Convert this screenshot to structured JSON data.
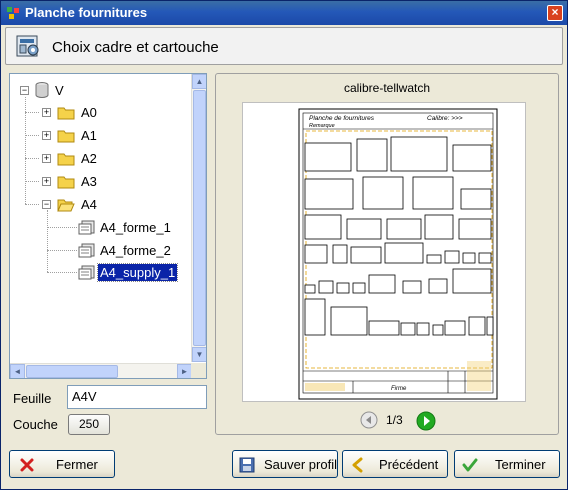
{
  "window": {
    "title": "Planche fournitures",
    "close": "×"
  },
  "header": {
    "title": "Choix cadre et cartouche"
  },
  "tree": {
    "root": "V",
    "folders": [
      "A0",
      "A1",
      "A2",
      "A3",
      "A4"
    ],
    "items": [
      "A4_forme_1",
      "A4_forme_2",
      "A4_supply_1"
    ],
    "selected": "A4_supply_1",
    "scroll_up": "▲",
    "scroll_down": "▼",
    "scroll_left": "◄",
    "scroll_right": "►"
  },
  "form": {
    "feuille_label": "Feuille",
    "feuille_value": "A4V",
    "couche_label": "Couche",
    "couche_value": "250"
  },
  "preview": {
    "title": "calibre-tellwatch",
    "sheet_header_left": "Planche de fournitures",
    "sheet_header_right": "Calibre:  >>>",
    "sheet_subheader": "Remarque",
    "sheet_footer_center": "Firme",
    "page": "1/3"
  },
  "buttons": {
    "close": "Fermer",
    "save": "Sauver profil",
    "previous": "Précédent",
    "finish": "Terminer"
  },
  "icons": {
    "app": "app-icon",
    "header": "folder-settings-icon",
    "database": "database-icon",
    "folder": "folder-icon",
    "template": "template-file-icon",
    "prev": "previous-circle-icon",
    "next": "next-play-icon",
    "close": "red-x-icon",
    "save": "floppy-disk-icon",
    "back": "chevron-left-icon",
    "finish": "checkmark-icon"
  },
  "colors": {
    "accent": "#0a24a8",
    "title_bar": "#2458b8",
    "next": "#22aa22",
    "close": "#d9411e"
  }
}
